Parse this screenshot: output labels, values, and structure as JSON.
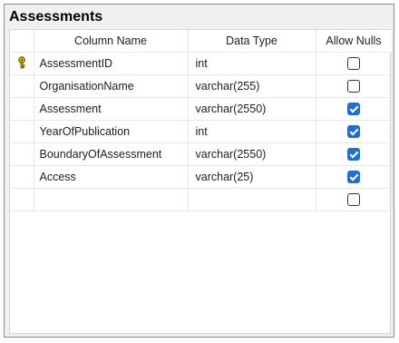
{
  "table": {
    "title": "Assessments",
    "columns": {
      "name": "Column Name",
      "type": "Data Type",
      "nulls": "Allow Nulls"
    },
    "rows": [
      {
        "name": "AssessmentID",
        "type": "int",
        "allow_nulls": false,
        "primary_key": true
      },
      {
        "name": "OrganisationName",
        "type": "varchar(255)",
        "allow_nulls": false,
        "primary_key": false
      },
      {
        "name": "Assessment",
        "type": "varchar(2550)",
        "allow_nulls": true,
        "primary_key": false
      },
      {
        "name": "YearOfPublication",
        "type": "int",
        "allow_nulls": true,
        "primary_key": false
      },
      {
        "name": "BoundaryOfAssessment",
        "type": "varchar(2550)",
        "allow_nulls": true,
        "primary_key": false
      },
      {
        "name": "Access",
        "type": "varchar(25)",
        "allow_nulls": true,
        "primary_key": false
      },
      {
        "name": "",
        "type": "",
        "allow_nulls": false,
        "primary_key": false
      }
    ]
  },
  "icons": {
    "primary_key": "key-icon"
  },
  "colors": {
    "checkbox_checked": "#1f6fd0",
    "key_icon": "#d8b400"
  }
}
